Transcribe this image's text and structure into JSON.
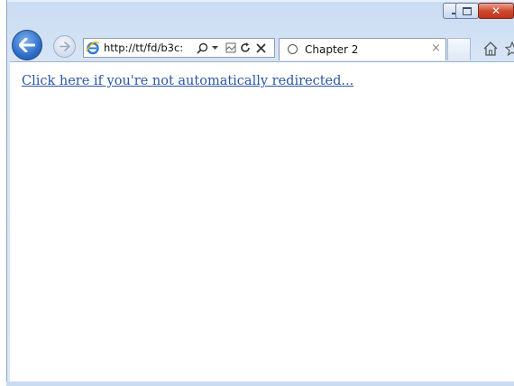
{
  "window": {
    "caption_buttons": {
      "minimize": "minimize-icon",
      "maximize": "maximize-icon",
      "close": "close-icon"
    }
  },
  "nav": {
    "back_icon": "arrow-left-icon",
    "forward_icon": "arrow-right-icon"
  },
  "address_bar": {
    "url": "http://tt/fd/b3c:",
    "search_icon": "search-icon",
    "dropdown_icon": "chevron-down-icon",
    "compat_icon": "compatibility-view-icon",
    "refresh_icon": "refresh-icon",
    "stop_icon": "stop-icon"
  },
  "tab": {
    "title": "Chapter 2",
    "close_glyph": "×",
    "loading_icon": "loading-spinner-icon"
  },
  "toolbar": {
    "home_icon": "home-icon",
    "favorites_icon": "star-icon"
  },
  "content": {
    "redirect_link": "Click here if you're not automatically redirected..."
  },
  "colors": {
    "link": "#2b56a8",
    "close_button": "#c0321c",
    "frame": "#d6e4f5",
    "back_button": "#2e6fc9"
  }
}
